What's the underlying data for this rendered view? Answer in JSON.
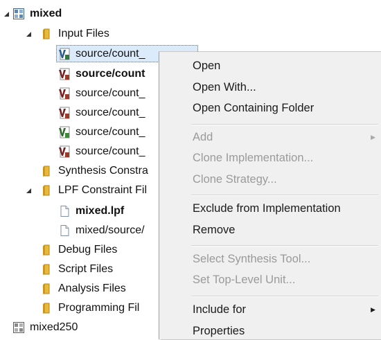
{
  "tree": {
    "project": "mixed",
    "input_files": {
      "label": "Input Files",
      "items": [
        "source/count_",
        "source/count",
        "source/count_",
        "source/count_",
        "source/count_",
        "source/count_"
      ]
    },
    "synthesis": "Synthesis Constra",
    "lpf": {
      "label": "LPF Constraint Fil",
      "items": [
        "mixed.lpf",
        "mixed/source/"
      ]
    },
    "debug": "Debug Files",
    "script": "Script Files",
    "analysis": "Analysis Files",
    "programming": "Programming Fil",
    "project2": "mixed250"
  },
  "menu": {
    "open": "Open",
    "open_with": "Open With...",
    "open_folder": "Open Containing Folder",
    "add": "Add",
    "clone_impl": "Clone Implementation...",
    "clone_strategy": "Clone Strategy...",
    "exclude": "Exclude from Implementation",
    "remove": "Remove",
    "select_synth": "Select Synthesis Tool...",
    "set_top": "Set Top-Level Unit...",
    "include_for": "Include for",
    "properties": "Properties",
    "submenu_arrow": "▶"
  },
  "colors": {
    "selection_bg": "#dcebfc",
    "menu_bg": "#f0f0f0",
    "disabled_text": "#9a9a9a",
    "folder": "#e8b93a"
  }
}
